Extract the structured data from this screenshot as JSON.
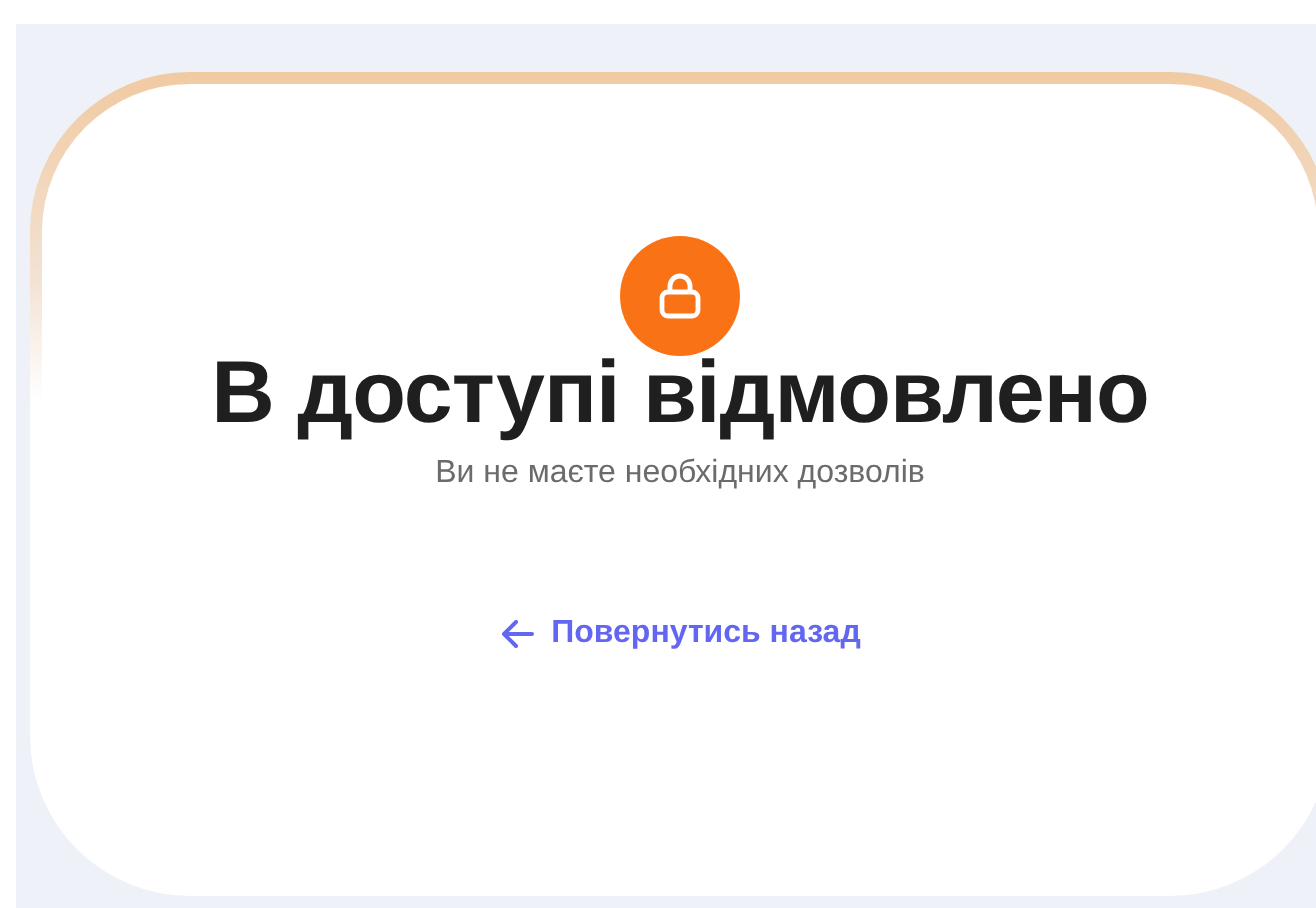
{
  "title": "В доступі відмовлено",
  "subtitle": "Ви не маєте необхідних дозволів",
  "back_link": {
    "label": "Повернутись назад"
  }
}
